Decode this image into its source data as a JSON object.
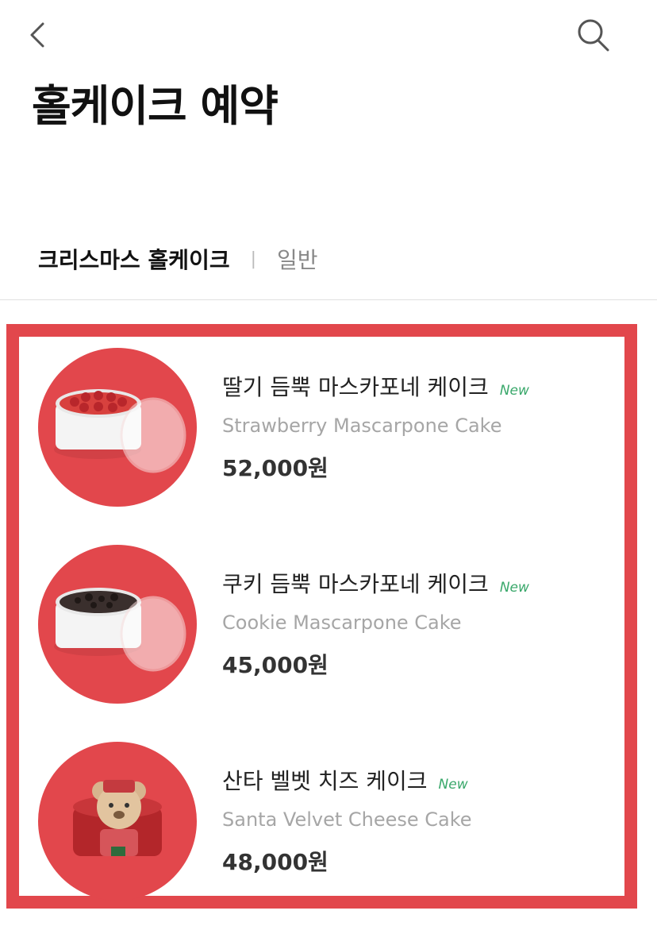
{
  "header": {
    "back_icon": "chevron-left-icon",
    "search_icon": "search-icon",
    "title": "홀케이크 예약"
  },
  "tabs": [
    {
      "label": "크리스마스 홀케이크",
      "active": true
    },
    {
      "label": "일반",
      "active": false
    }
  ],
  "colors": {
    "accent_red": "#e2474c",
    "new_badge_green": "#3aa86b"
  },
  "products": [
    {
      "name": "딸기 듬뿍 마스카포네 케이크",
      "badge": "New",
      "english_name": "Strawberry Mascarpone Cake",
      "price": "52,000원"
    },
    {
      "name": "쿠키 듬뿍 마스카포네 케이크",
      "badge": "New",
      "english_name": "Cookie Mascarpone Cake",
      "price": "45,000원"
    },
    {
      "name": "산타 벨벳 치즈 케이크",
      "badge": "New",
      "english_name": "Santa Velvet Cheese Cake",
      "price": "48,000원"
    }
  ]
}
